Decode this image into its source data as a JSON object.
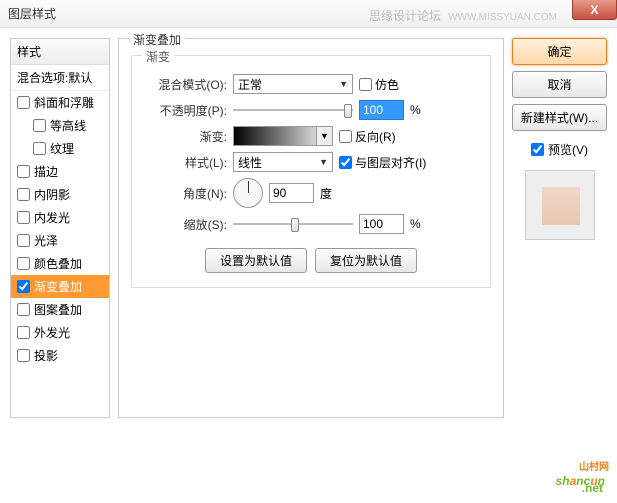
{
  "titlebar": {
    "title": "图层样式",
    "watermark": "思缘设计论坛",
    "watermark_url": "WWW.MISSYUAN.COM"
  },
  "styles_panel": {
    "header": "样式",
    "subheader": "混合选项:默认",
    "items": [
      {
        "label": "斜面和浮雕",
        "checked": false
      },
      {
        "label": "等高线",
        "checked": false,
        "indent": true
      },
      {
        "label": "纹理",
        "checked": false,
        "indent": true
      },
      {
        "label": "描边",
        "checked": false
      },
      {
        "label": "内阴影",
        "checked": false
      },
      {
        "label": "内发光",
        "checked": false
      },
      {
        "label": "光泽",
        "checked": false
      },
      {
        "label": "颜色叠加",
        "checked": false
      },
      {
        "label": "渐变叠加",
        "checked": true,
        "selected": true
      },
      {
        "label": "图案叠加",
        "checked": false
      },
      {
        "label": "外发光",
        "checked": false
      },
      {
        "label": "投影",
        "checked": false
      }
    ]
  },
  "main": {
    "fieldset_title": "渐变叠加",
    "inner_title": "渐变",
    "blend_mode_label": "混合模式(O):",
    "blend_mode_value": "正常",
    "dither_label": "仿色",
    "opacity_label": "不透明度(P):",
    "opacity_value": "100",
    "percent": "%",
    "gradient_label": "渐变:",
    "reverse_label": "反向(R)",
    "style_label": "样式(L):",
    "style_value": "线性",
    "align_label": "与图层对齐(I)",
    "align_checked": true,
    "angle_label": "角度(N):",
    "angle_value": "90",
    "angle_unit": "度",
    "scale_label": "缩放(S):",
    "scale_value": "100",
    "reset_btn": "设置为默认值",
    "restore_btn": "复位为默认值"
  },
  "right": {
    "ok": "确定",
    "cancel": "取消",
    "newstyle": "新建样式(W)...",
    "preview_label": "预览(V)",
    "preview_checked": true
  },
  "logo": {
    "text1": "sh",
    "text2": "a",
    "text3": "nc",
    "text4": "u",
    "text5": "n",
    "sub": "山村网",
    "net": ".net"
  }
}
